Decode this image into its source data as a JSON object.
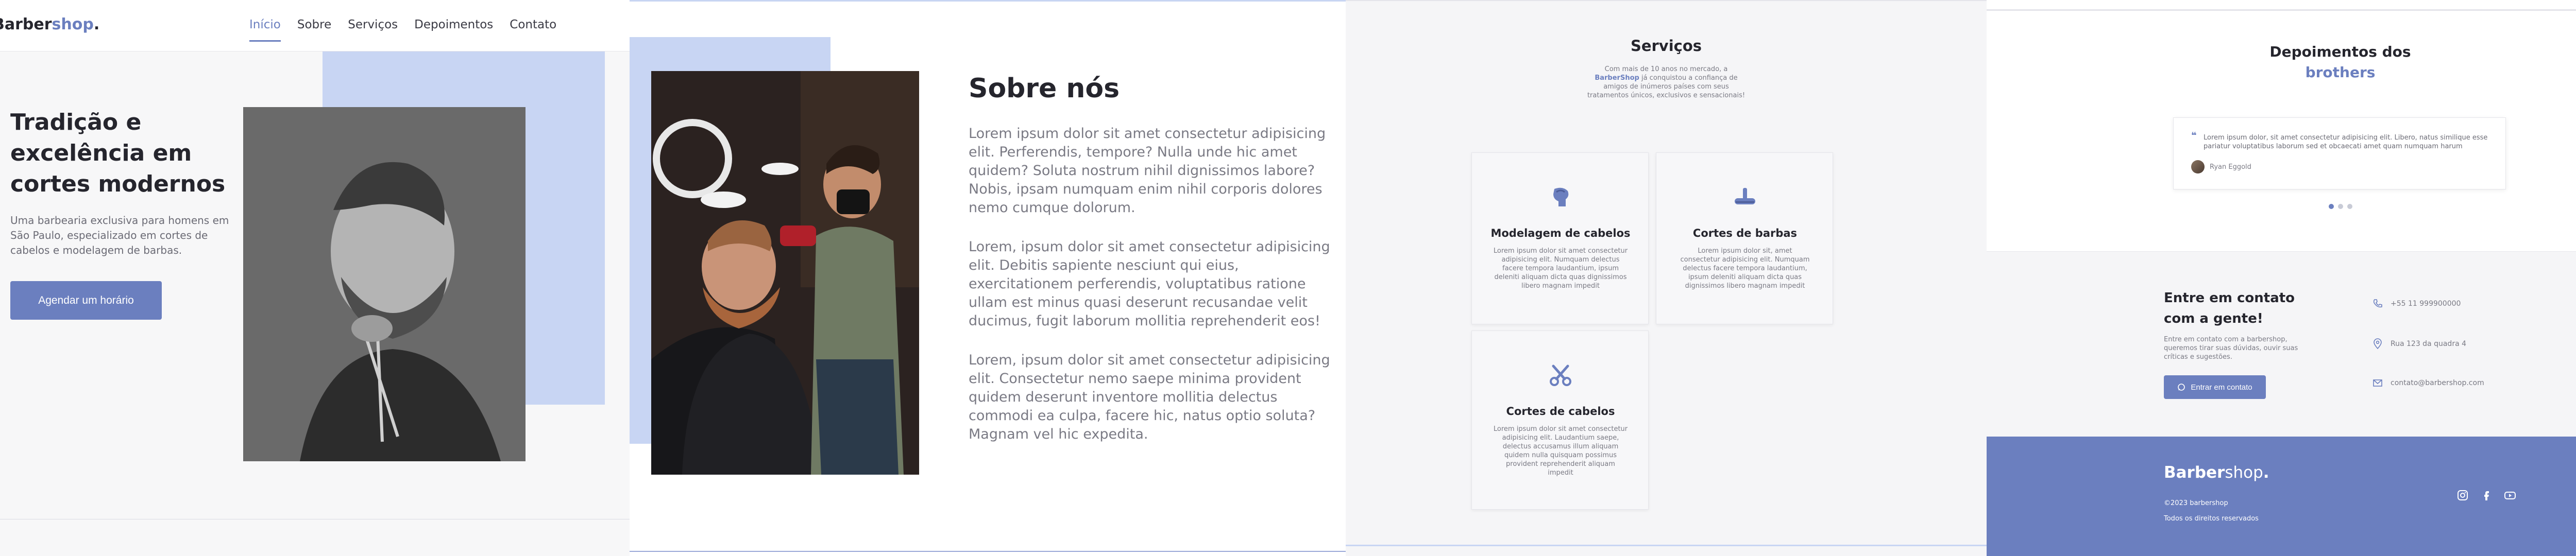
{
  "brand": {
    "name": "Barber",
    "accent": "shop",
    "dot": ".",
    "color": "#6b7fbf",
    "light_accent": "#c8d5f3"
  },
  "nav": [
    {
      "label": "Início",
      "active": true
    },
    {
      "label": "Sobre",
      "active": false
    },
    {
      "label": "Serviços",
      "active": false
    },
    {
      "label": "Depoimentos",
      "active": false
    },
    {
      "label": "Contato",
      "active": false
    }
  ],
  "hero": {
    "title": "Tradição e excelência em cortes modernos",
    "description": "Uma barbearia exclusiva para homens em São Paulo, especializado em cortes de cabelos e modelagem de barbas.",
    "button": "Agendar um horário"
  },
  "about": {
    "title": "Sobre nós",
    "paragraphs": [
      "Lorem ipsum dolor sit amet consectetur adipisicing elit. Perferendis, tempore? Nulla unde hic amet quidem? Soluta nostrum nihil dignissimos labore? Nobis, ipsam numquam enim nihil corporis dolores nemo cumque dolorum.",
      "Lorem, ipsum dolor sit amet consectetur adipisicing elit. Debitis sapiente nesciunt qui eius, exercitationem perferendis, voluptatibus ratione ullam est minus quasi deserunt recusandae velit ducimus, fugit laborum mollitia reprehenderit eos!",
      "Lorem, ipsum dolor sit amet consectetur adipisicing elit. Consectetur nemo saepe minima provident quidem deserunt inventore mollitia delectus commodi ea culpa, facere hic, natus optio soluta? Magnam vel hic expedita."
    ]
  },
  "services": {
    "title": "Serviços",
    "intro_prefix": "Com mais de 10 anos no mercado, a ",
    "intro_brand": "BarberShop",
    "intro_suffix": " já conquistou a confiança de amigos de inúmeros países com seus tratamentos únicos, exclusivos e sensacionais!",
    "cards": [
      {
        "icon": "hair-styling-icon",
        "title": "Modelagem de cabelos",
        "text": "Lorem ipsum dolor sit amet consectetur adipisicing elit. Numquam delectus facere tempora laudantium, ipsum deleniti aliquam dicta quas dignissimos libero magnam impedit"
      },
      {
        "icon": "razor-icon",
        "title": "Cortes de barbas",
        "text": "Lorem ipsum dolor sit, amet consectetur adipisicing elit. Numquam delectus facere tempora laudantium, ipsum deleniti aliquam dicta quas dignissimos libero magnam impedit"
      },
      {
        "icon": "scissors-icon",
        "title": "Cortes de cabelos",
        "text": "Lorem ipsum dolor sit amet consectetur adipisicing elit. Laudantium saepe, delectus accusamus illum aliquam quidem nulla quisquam possimus provident reprehenderit aliquam impedit"
      }
    ]
  },
  "testimonials": {
    "title_line1": "Depoimentos dos",
    "title_line2": "brothers",
    "quote": "Lorem ipsum dolor, sit amet consectetur adipisicing elit. Libero, natus similique esse pariatur voluptatibus laborum sed et obcaecati amet quam numquam harum",
    "author": "Ryan Eggold",
    "slides_total": 3,
    "slide_active": 1
  },
  "contact": {
    "title": "Entre em contato com a gente!",
    "description": "Entre em contato com a barbershop, queremos tirar suas dúvidas, ouvir suas críticas e sugestões.",
    "button": "Entrar em contato",
    "phone": "+55 11 999900000",
    "address": "Rua 123 da quadra 4",
    "email": "contato@barbershop.com"
  },
  "footer": {
    "copyright": "©2023 barbershop",
    "rights": "Todos os direitos reservados"
  }
}
